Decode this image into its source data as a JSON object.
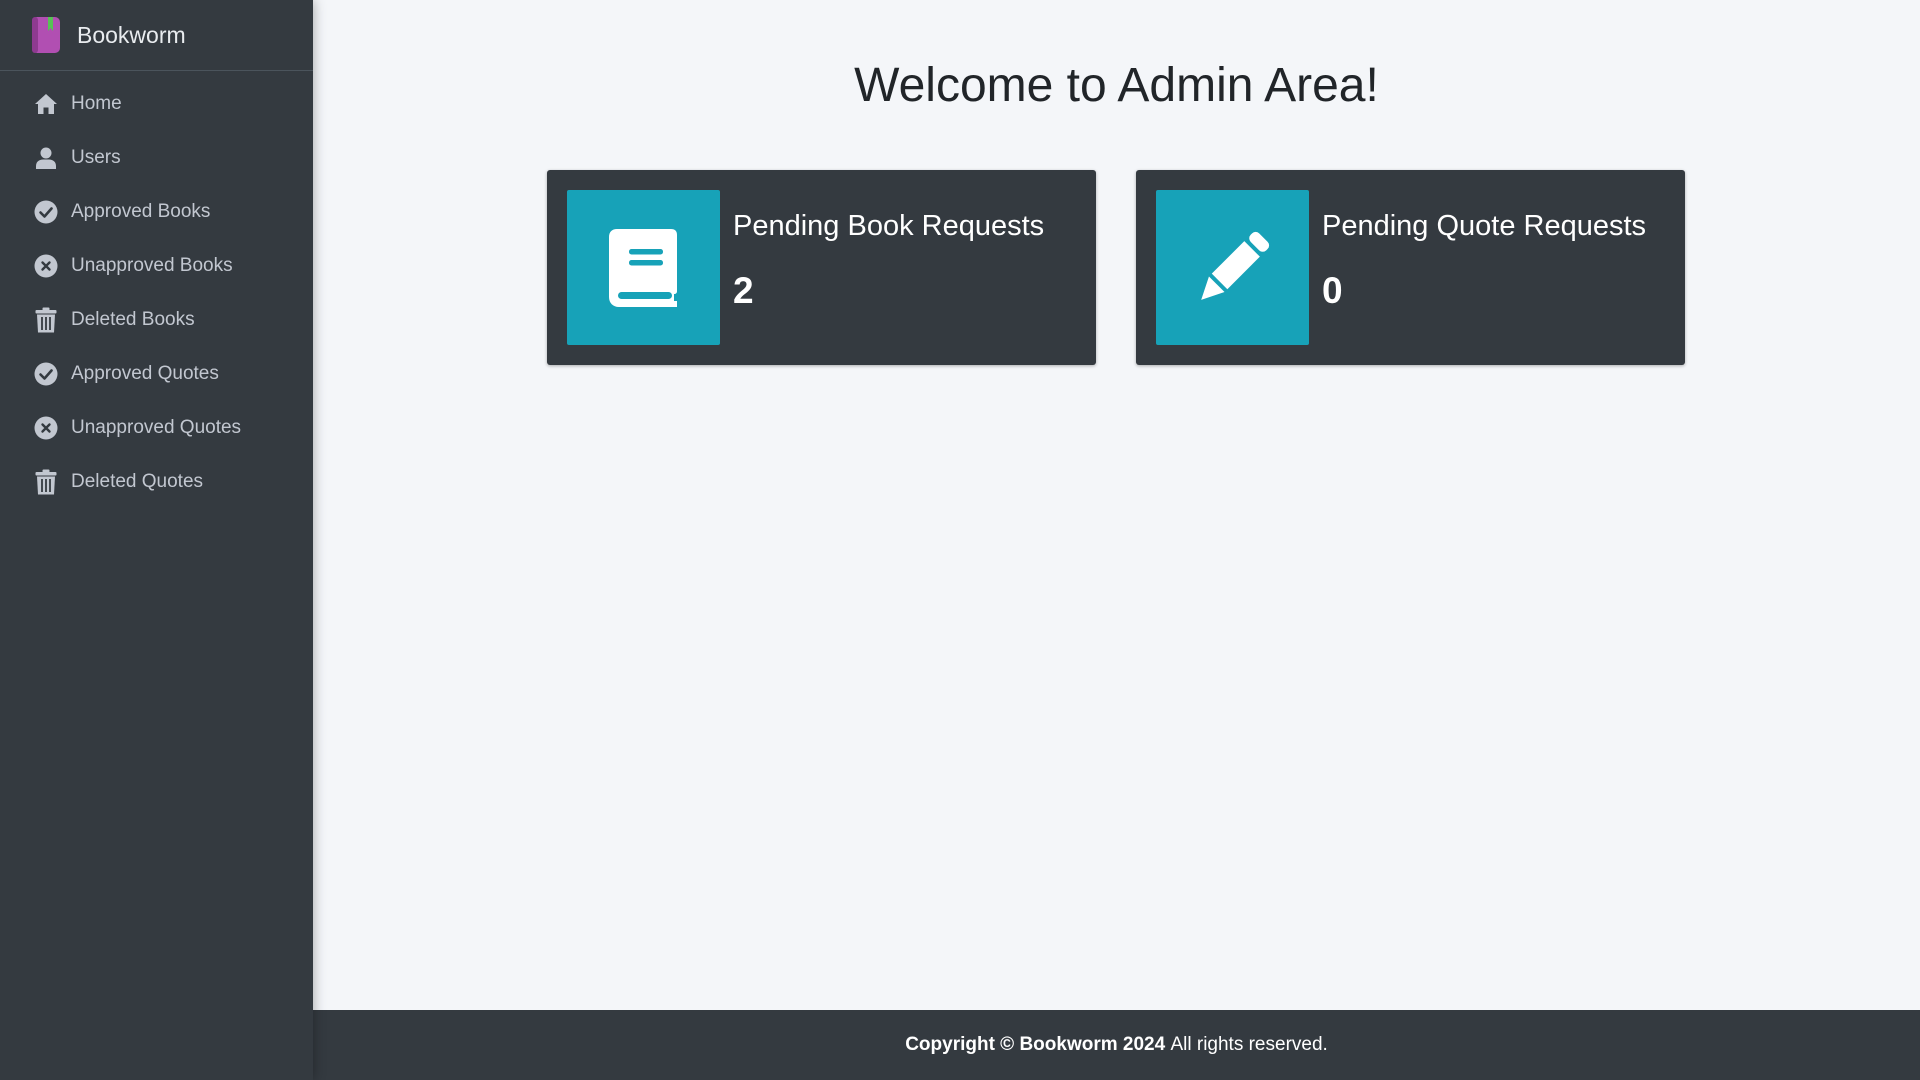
{
  "brand": {
    "name": "Bookworm",
    "logo_icon": "book-bookmark-icon",
    "logo_color": "#b14fb2",
    "bookmark_color": "#57c255"
  },
  "sidebar": {
    "items": [
      {
        "label": "Home",
        "icon": "home-icon"
      },
      {
        "label": "Users",
        "icon": "user-icon"
      },
      {
        "label": "Approved Books",
        "icon": "check-circle-icon"
      },
      {
        "label": "Unapproved Books",
        "icon": "x-circle-icon"
      },
      {
        "label": "Deleted Books",
        "icon": "trash-icon"
      },
      {
        "label": "Approved Quotes",
        "icon": "check-circle-icon"
      },
      {
        "label": "Unapproved Quotes",
        "icon": "x-circle-icon"
      },
      {
        "label": "Deleted Quotes",
        "icon": "trash-icon"
      }
    ]
  },
  "main": {
    "title": "Welcome to Admin Area!",
    "cards": [
      {
        "label": "Pending Book Requests",
        "count": "2",
        "icon": "book-icon"
      },
      {
        "label": "Pending Quote Requests",
        "count": "0",
        "icon": "pencil-icon"
      }
    ]
  },
  "footer": {
    "copyright": "Copyright © Bookworm 2024",
    "rights": "All rights reserved."
  },
  "colors": {
    "sidebar_bg": "#343a40",
    "accent": "#17a2b8",
    "page_bg": "#f4f6f9"
  }
}
